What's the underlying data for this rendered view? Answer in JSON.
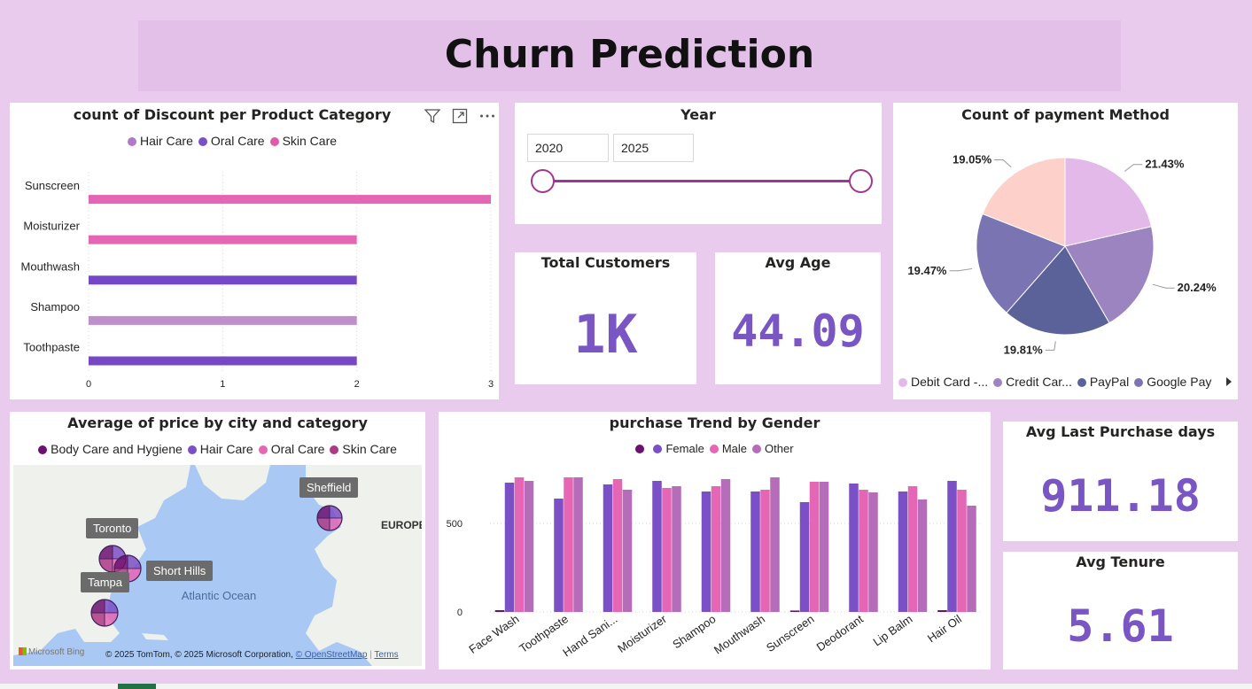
{
  "header": {
    "title": "Churn Prediction"
  },
  "discount_chart": {
    "title": "count of Discount per Product Category",
    "chart_data": {
      "type": "bar",
      "orientation": "horizontal",
      "title": "count of Discount per Product Category",
      "categories": [
        "Sunscreen",
        "Moisturizer",
        "Mouthwash",
        "Shampoo",
        "Toothpaste"
      ],
      "values": [
        3,
        2,
        2,
        2,
        2
      ],
      "bar_series": [
        "Skin Care",
        "Skin Care",
        "Oral Care",
        "Hair Care",
        "Oral Care"
      ],
      "legend": [
        {
          "name": "Hair Care",
          "color": "#b07ac8"
        },
        {
          "name": "Oral Care",
          "color": "#7b4fc6"
        },
        {
          "name": "Skin Care",
          "color": "#e05ca8"
        }
      ],
      "bar_colors": [
        "#e466b4",
        "#e466b4",
        "#7647c6",
        "#bf8fcc",
        "#7647c6"
      ],
      "xticks": [
        "0",
        "1",
        "2",
        "3"
      ],
      "xlim": [
        0,
        3
      ],
      "grid": true,
      "legend_position": "top"
    }
  },
  "year_slicer": {
    "title": "Year",
    "start": "2020",
    "end": "2025"
  },
  "total_customers": {
    "label": "Total Customers",
    "value": "1K"
  },
  "avg_age": {
    "label": "Avg Age",
    "value": "44.09"
  },
  "payment_chart": {
    "title": "Count of payment Method",
    "chart_data": {
      "type": "pie",
      "title": "Count of payment Method",
      "slices": [
        {
          "name": "Debit Card -...",
          "label": "21.43%",
          "value": 21.43,
          "color": "#e3b9ea"
        },
        {
          "name": "Credit Car...",
          "label": "20.24%",
          "value": 20.24,
          "color": "#9b84bf"
        },
        {
          "name": "PayPal",
          "label": "19.81%",
          "value": 19.81,
          "color": "#5b6299"
        },
        {
          "name": "Google Pay",
          "label": "19.47%",
          "value": 19.47,
          "color": "#7a74b2"
        },
        {
          "name": "",
          "label": "19.05%",
          "value": 19.05,
          "color": "#fdd0ca"
        }
      ],
      "legend_position": "bottom"
    },
    "legend_more_icon": "chevron-right-icon"
  },
  "map_panel": {
    "title": "Average of price by city and category",
    "legend": [
      {
        "name": "Body Care and Hygiene",
        "color": "#6b1170"
      },
      {
        "name": "Hair Care",
        "color": "#7b4fc6"
      },
      {
        "name": "Oral Care",
        "color": "#e466b4"
      },
      {
        "name": "Skin Care",
        "color": "#ad3a85"
      }
    ],
    "cities": [
      "Sheffield",
      "Toronto",
      "Short Hills",
      "Tampa"
    ],
    "map_labels": {
      "europe": "EUROPE",
      "ocean": "Atlantic Ocean"
    },
    "attribution": {
      "logo": "Microsoft Bing",
      "text": "© 2025 TomTom, © 2025 Microsoft Corporation,",
      "osm": "© OpenStreetMap",
      "terms": "Terms"
    },
    "colors": {
      "land": "#eef1ec",
      "water": "#a9c8f3"
    }
  },
  "purchase_chart": {
    "title": "purchase Trend by Gender",
    "chart_data": {
      "type": "bar",
      "title": "purchase Trend by Gender",
      "categories": [
        "Face Wash",
        "Toothpaste",
        "Hand Sani...",
        "Moisturizer",
        "Shampoo",
        "Mouthwash",
        "Sunscreen",
        "Deodorant",
        "Lip Balm",
        "Hair Oil"
      ],
      "legend_marker_color": "#6b1170",
      "series": [
        {
          "name": "",
          "color": "#6b1170",
          "values": [
            10,
            0,
            0,
            0,
            0,
            0,
            8,
            0,
            0,
            10
          ]
        },
        {
          "name": "Female",
          "color": "#7b4fc6",
          "values": [
            730,
            640,
            720,
            740,
            680,
            680,
            620,
            725,
            680,
            740
          ]
        },
        {
          "name": "Male",
          "color": "#e466b4",
          "values": [
            760,
            760,
            750,
            700,
            710,
            690,
            735,
            690,
            710,
            690
          ]
        },
        {
          "name": "Other",
          "color": "#b56cb9",
          "values": [
            740,
            760,
            690,
            710,
            750,
            760,
            735,
            675,
            635,
            600
          ]
        }
      ],
      "yticks": [
        "0",
        "500"
      ],
      "ylim": [
        0,
        850
      ],
      "grid": true,
      "legend_position": "top"
    }
  },
  "avg_last_purchase": {
    "label": "Avg Last Purchase days",
    "value": "911.18"
  },
  "avg_tenure": {
    "label": "Avg Tenure",
    "value": "5.61"
  },
  "colors": {
    "background": "#e8cbed",
    "header_bg": "#e2c0e8",
    "accent": "#7a55c4",
    "slider": "#a0378f"
  }
}
